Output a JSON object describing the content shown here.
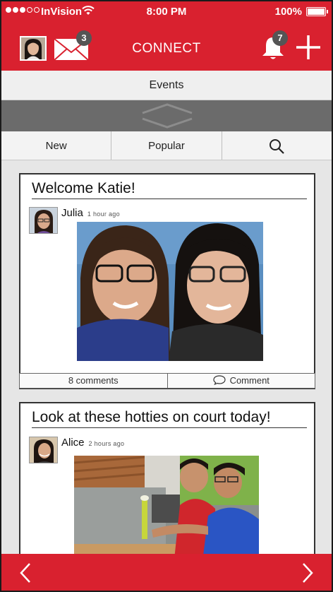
{
  "status": {
    "carrier": "InVision",
    "time": "8:00 PM",
    "battery": "100%"
  },
  "header": {
    "title": "CONNECT",
    "mail_count": "3",
    "notification_count": "7"
  },
  "events_label": "Events",
  "tabs": [
    {
      "label": "New"
    },
    {
      "label": "Popular"
    },
    {
      "label": "",
      "icon": "search-icon"
    }
  ],
  "posts": [
    {
      "title": "Welcome Katie!",
      "author": "Julia",
      "time_ago": "1 hour ago",
      "comments": "8 comments",
      "comment_action": "Comment"
    },
    {
      "title": "Look at these hotties on court today!",
      "author": "Alice",
      "time_ago": "2 hours ago"
    }
  ],
  "colors": {
    "brand_red": "#d9212f",
    "handle_gray": "#6b6b6b",
    "badge_gray": "#555555"
  }
}
